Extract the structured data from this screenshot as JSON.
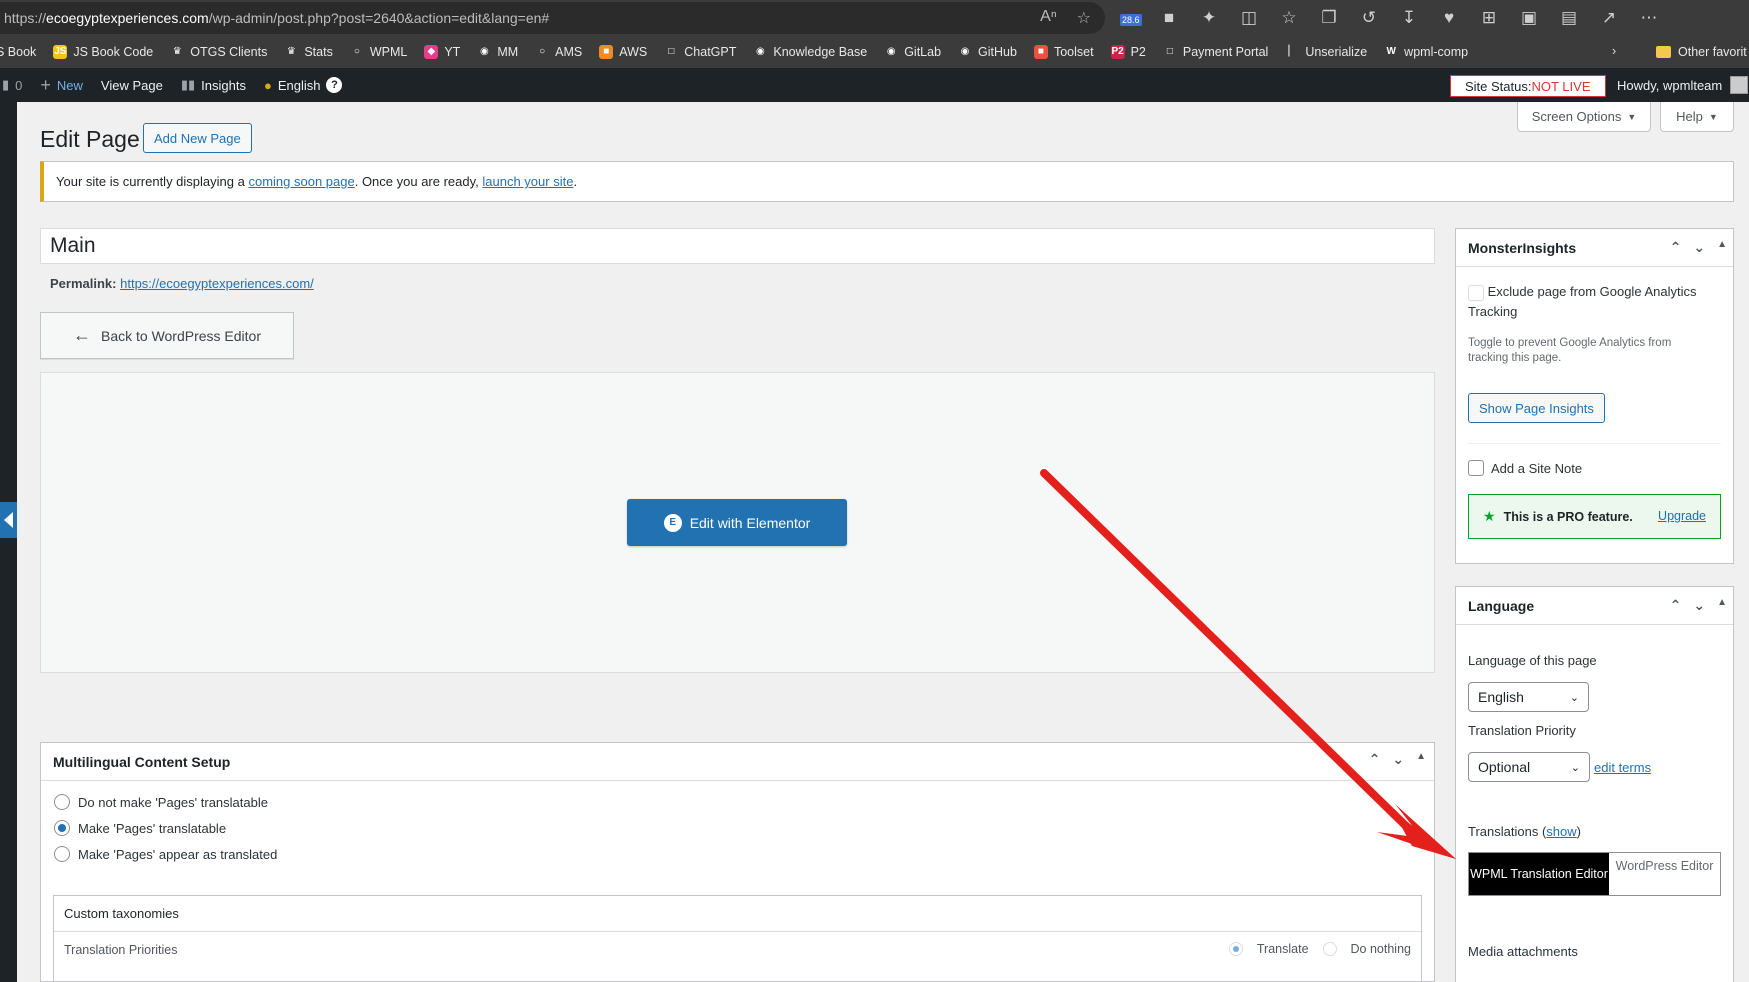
{
  "browser": {
    "url_prefix": "https://",
    "url_domain": "ecoegyptexperiences.com",
    "url_path": "/wp-admin/post.php?post=2640&action=edit&lang=en#",
    "ext_badge": "28.6",
    "bookmarks": [
      {
        "label": "S Book",
        "icon": "",
        "color": "#3b3b3b"
      },
      {
        "label": "JS Book Code",
        "icon": "JS",
        "color": "#f0c419"
      },
      {
        "label": "OTGS Clients",
        "icon": "♛",
        "color": "#3b3b3b"
      },
      {
        "label": "Stats",
        "icon": "♛",
        "color": "#3b3b3b"
      },
      {
        "label": "WPML",
        "icon": "○",
        "color": "#3b3b3b"
      },
      {
        "label": "YT",
        "icon": "◆",
        "color": "#e63c8c"
      },
      {
        "label": "MM",
        "icon": "◉",
        "color": "#3b3b3b"
      },
      {
        "label": "AMS",
        "icon": "○",
        "color": "#3b3b3b"
      },
      {
        "label": "AWS",
        "icon": "■",
        "color": "#f08a24"
      },
      {
        "label": "ChatGPT",
        "icon": "□",
        "color": "#3b3b3b"
      },
      {
        "label": "Knowledge Base",
        "icon": "◉",
        "color": "#3b3b3b"
      },
      {
        "label": "GitLab",
        "icon": "◉",
        "color": "#3b3b3b"
      },
      {
        "label": "GitHub",
        "icon": "◉",
        "color": "#3b3b3b"
      },
      {
        "label": "Toolset",
        "icon": "■",
        "color": "#e8513c"
      },
      {
        "label": "P2",
        "icon": "P2",
        "color": "#c8254a"
      },
      {
        "label": "Payment Portal",
        "icon": "□",
        "color": "#3b3b3b"
      },
      {
        "label": "Unserialize",
        "icon": "▏",
        "color": "#3b3b3b"
      },
      {
        "label": "wpml-comp",
        "icon": "W",
        "color": "#3b3b3b"
      }
    ],
    "other_favorites": "Other favorit"
  },
  "adminbar": {
    "comments_count": "0",
    "new_label": "New",
    "view_page": "View Page",
    "insights": "Insights",
    "language": "English",
    "site_status_prefix": "Site Status: ",
    "site_status_value": "NOT LIVE",
    "howdy": "Howdy, wpmlteam"
  },
  "screen_options": "Screen Options",
  "help": "Help",
  "page": {
    "title": "Edit Page",
    "add_new": "Add New Page",
    "notice_pre": "Your site is currently displaying a ",
    "notice_link1": "coming soon page",
    "notice_mid": ". Once you are ready, ",
    "notice_link2": "launch your site",
    "notice_post": ".",
    "post_title": "Main",
    "permalink_label": "Permalink:",
    "permalink_url": "https://ecoegyptexperiences.com/",
    "back_button": "Back to WordPress Editor",
    "edit_elementor": "Edit with Elementor"
  },
  "multilingual": {
    "heading": "Multilingual Content Setup",
    "options": [
      "Do not make 'Pages' translatable",
      "Make 'Pages' translatable",
      "Make 'Pages' appear as translated"
    ],
    "selected_index": 1,
    "custom_taxonomies": "Custom taxonomies",
    "translation_priorities": "Translation Priorities",
    "translate": "Translate",
    "do_nothing": "Do nothing"
  },
  "monsterinsights": {
    "heading": "MonsterInsights",
    "exclude_label": "Exclude page from Google Analytics Tracking",
    "exclude_help": "Toggle to prevent Google Analytics from tracking this page.",
    "show_insights": "Show Page Insights",
    "site_note": "Add a Site Note",
    "pro_feature": "This is a PRO feature.",
    "upgrade": "Upgrade"
  },
  "language_box": {
    "heading": "Language",
    "language_of_page": "Language of this page",
    "language_value": "English",
    "translation_priority": "Translation Priority",
    "priority_value": "Optional",
    "edit_terms": "edit terms",
    "translations": "Translations",
    "show_open": "(",
    "show_link": "show",
    "show_close": ")",
    "tab_wpml": "WPML Translation Editor",
    "tab_wp": "WordPress Editor",
    "media_attachments": "Media attachments"
  },
  "colors": {
    "wp_blue": "#2271b1",
    "admin_dark": "#1d2327",
    "arrow_red": "#e3201b",
    "pro_green": "#00a32a"
  }
}
